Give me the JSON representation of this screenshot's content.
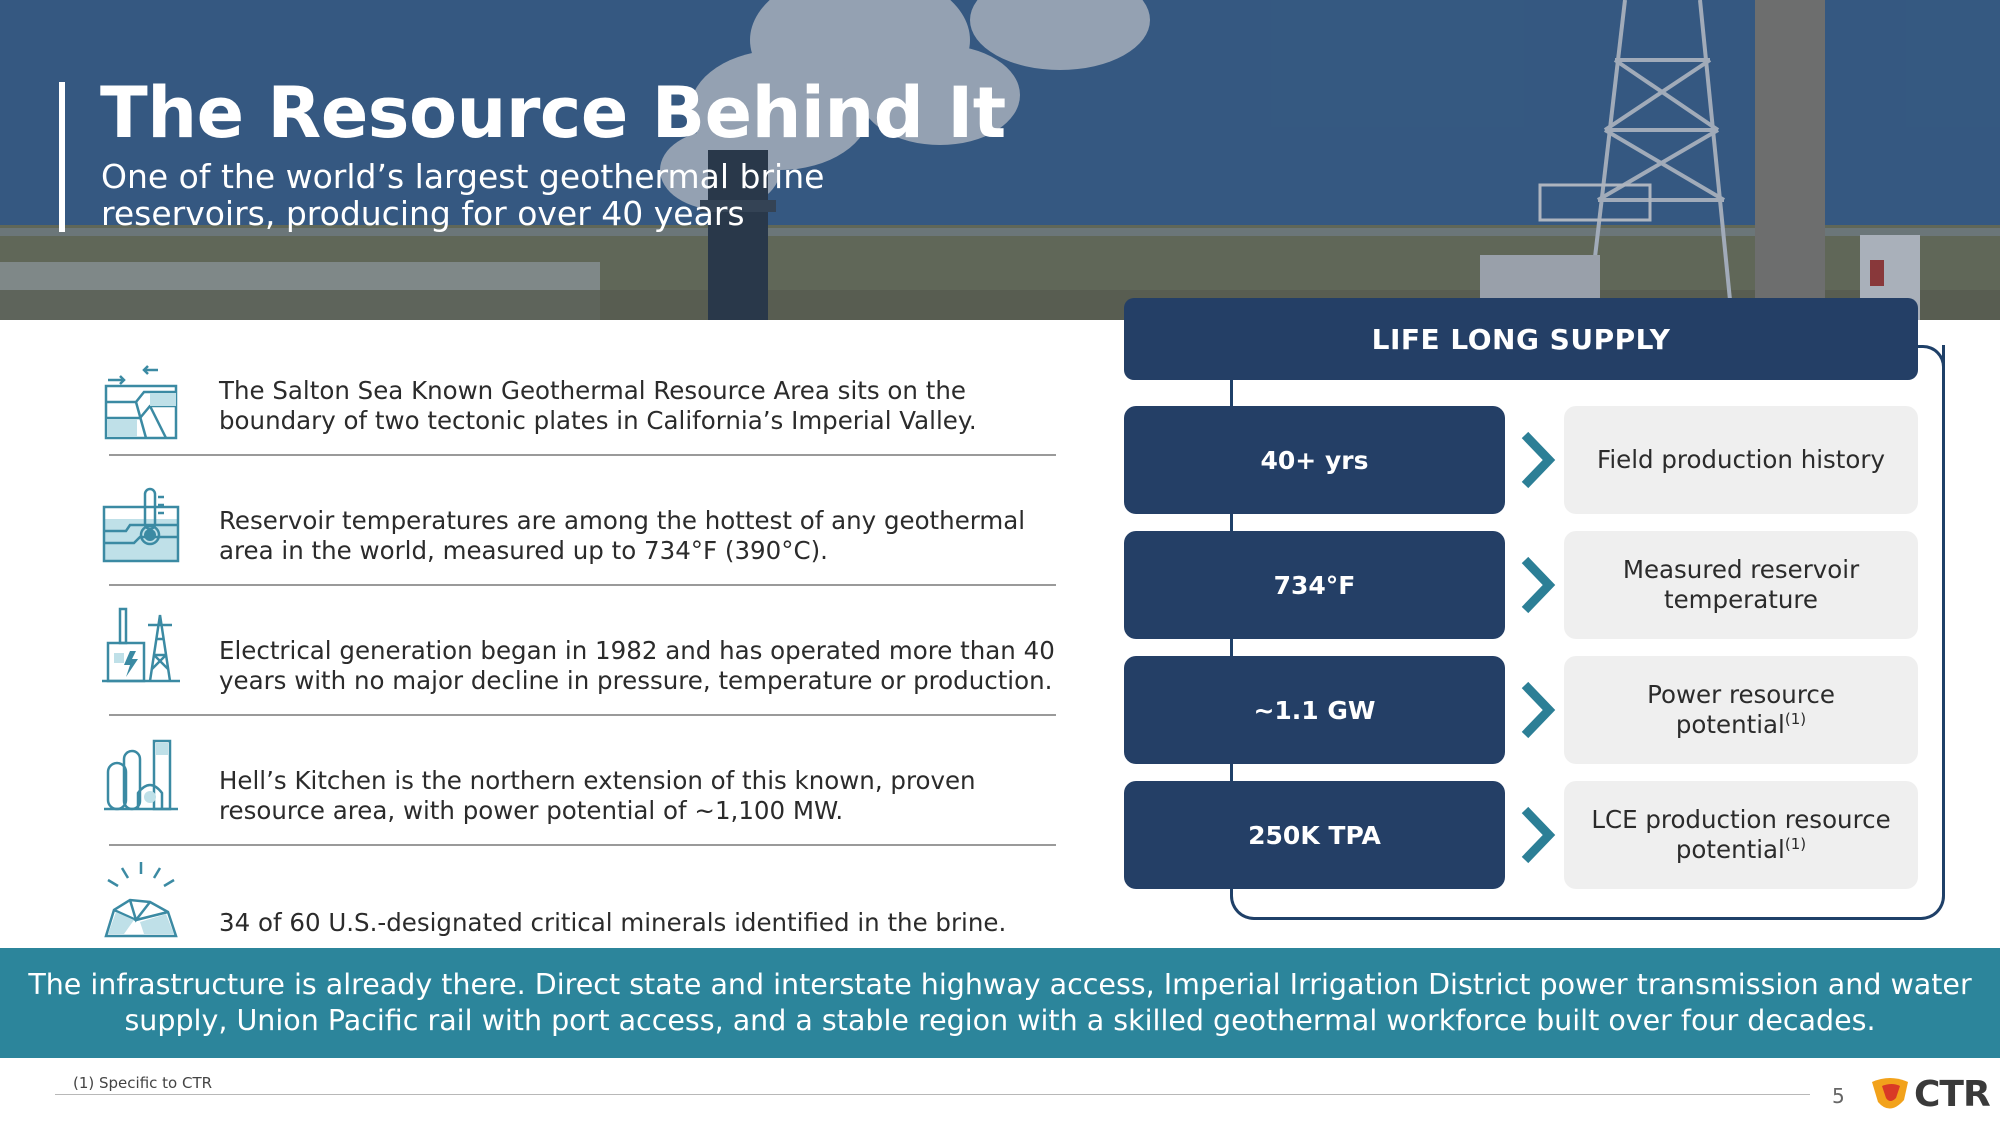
{
  "hero": {
    "title": "The Resource Behind It",
    "subtitle": "One of the world’s largest geothermal brine reservoirs, producing for over 40 years"
  },
  "features": [
    {
      "icon": "tectonic-plates-icon",
      "text": "The Salton Sea Known Geothermal Resource Area sits on the boundary of two tectonic plates in California’s Imperial Valley."
    },
    {
      "icon": "thermometer-reservoir-icon",
      "text": "Reservoir temperatures are among the hottest of any geothermal area in the world, measured up to 734°F (390°C)."
    },
    {
      "icon": "power-plant-icon",
      "text": "Electrical generation began in 1982 and has operated more than 40 years with no major decline in pressure, temperature or production."
    },
    {
      "icon": "storage-tanks-icon",
      "text": "Hell’s Kitchen is the northern extension of this known, proven resource area, with power potential of ~1,100 MW."
    },
    {
      "icon": "minerals-rock-icon",
      "text": "34 of 60 U.S.-designated critical minerals identified in the brine."
    }
  ],
  "supply": {
    "header": "LIFE LONG SUPPLY",
    "rows": [
      {
        "metric": "40+ yrs",
        "desc": "Field production history",
        "sup": ""
      },
      {
        "metric": "734°F",
        "desc": "Measured reservoir temperature",
        "sup": ""
      },
      {
        "metric": "~1.1 GW",
        "desc": "Power resource potential",
        "sup": "(1)"
      },
      {
        "metric": "250K TPA",
        "desc": "LCE production resource potential",
        "sup": "(1)"
      }
    ]
  },
  "band": {
    "text": "The infrastructure is already there. Direct state and interstate highway access, Imperial Irrigation District power transmission and water supply, Union Pacific rail with port access, and a stable region with a skilled geothermal workforce built over four decades."
  },
  "footer": {
    "footnote": "(1) Specific to CTR",
    "page_number": "5",
    "logo_text": "CTR"
  },
  "colors": {
    "navy": "#243f66",
    "teal": "#2c859b",
    "chevron": "#2c7f96",
    "icon": "#3b8aa3",
    "box_grey": "#efefef"
  }
}
